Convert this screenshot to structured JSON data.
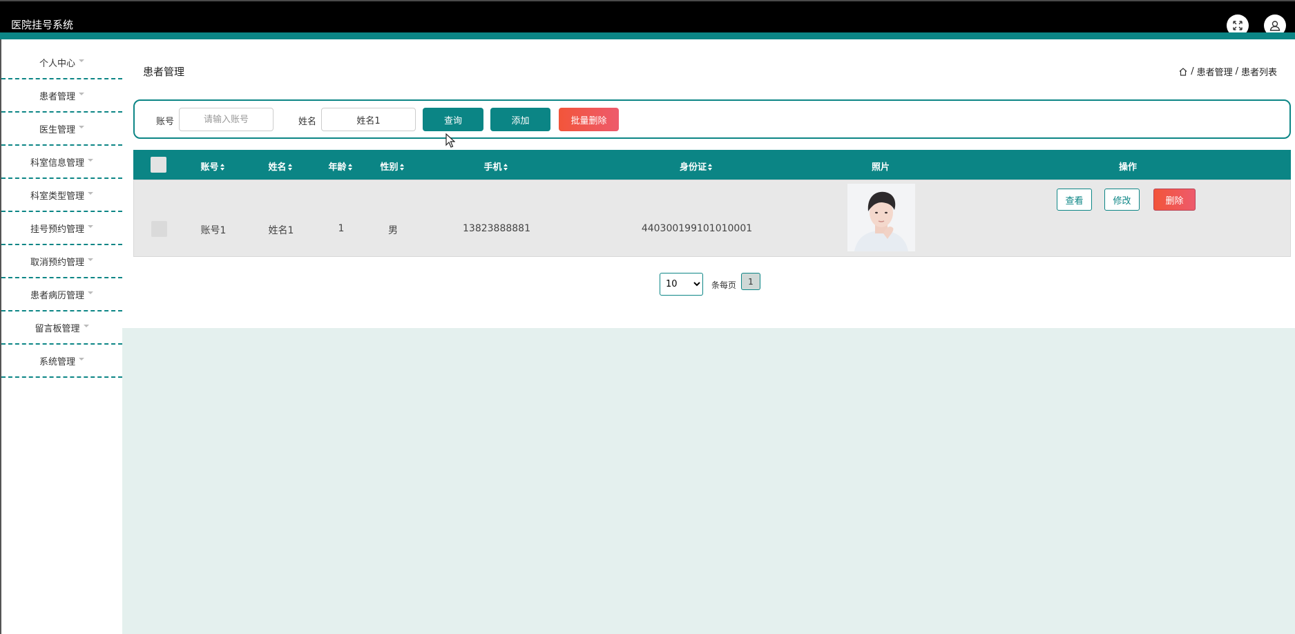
{
  "app": {
    "title": "医院挂号系统"
  },
  "sidebar": {
    "items": [
      {
        "label": "个人中心"
      },
      {
        "label": "患者管理"
      },
      {
        "label": "医生管理"
      },
      {
        "label": "科室信息管理"
      },
      {
        "label": "科室类型管理"
      },
      {
        "label": "挂号预约管理"
      },
      {
        "label": "取消预约管理"
      },
      {
        "label": "患者病历管理"
      },
      {
        "label": "留言板管理"
      },
      {
        "label": "系统管理"
      }
    ]
  },
  "page": {
    "title": "患者管理",
    "breadcrumb": [
      "患者管理",
      "患者列表"
    ]
  },
  "search": {
    "account_label": "账号",
    "account_placeholder": "请输入账号",
    "name_label": "姓名",
    "name_value": "姓名1",
    "query_label": "查询",
    "add_label": "添加",
    "batch_delete_label": "批量删除"
  },
  "table": {
    "headers": {
      "account": "账号",
      "name": "姓名",
      "age": "年龄",
      "gender": "性别",
      "phone": "手机",
      "id_card": "身份证",
      "photo": "照片",
      "actions": "操作"
    },
    "rows": [
      {
        "account": "账号1",
        "name": "姓名1",
        "age": "1",
        "gender": "男",
        "phone": "13823888881",
        "id_card": "440300199101010001"
      }
    ],
    "action_labels": {
      "view": "查看",
      "edit": "修改",
      "delete": "删除"
    }
  },
  "pagination": {
    "page_size": "10",
    "page_size_options": [
      "10"
    ],
    "per_page_label": "条每页",
    "current_page": "1"
  },
  "colors": {
    "primary": "#0b8585",
    "danger": "#f2553a",
    "content_bg": "#e4f0ee"
  }
}
